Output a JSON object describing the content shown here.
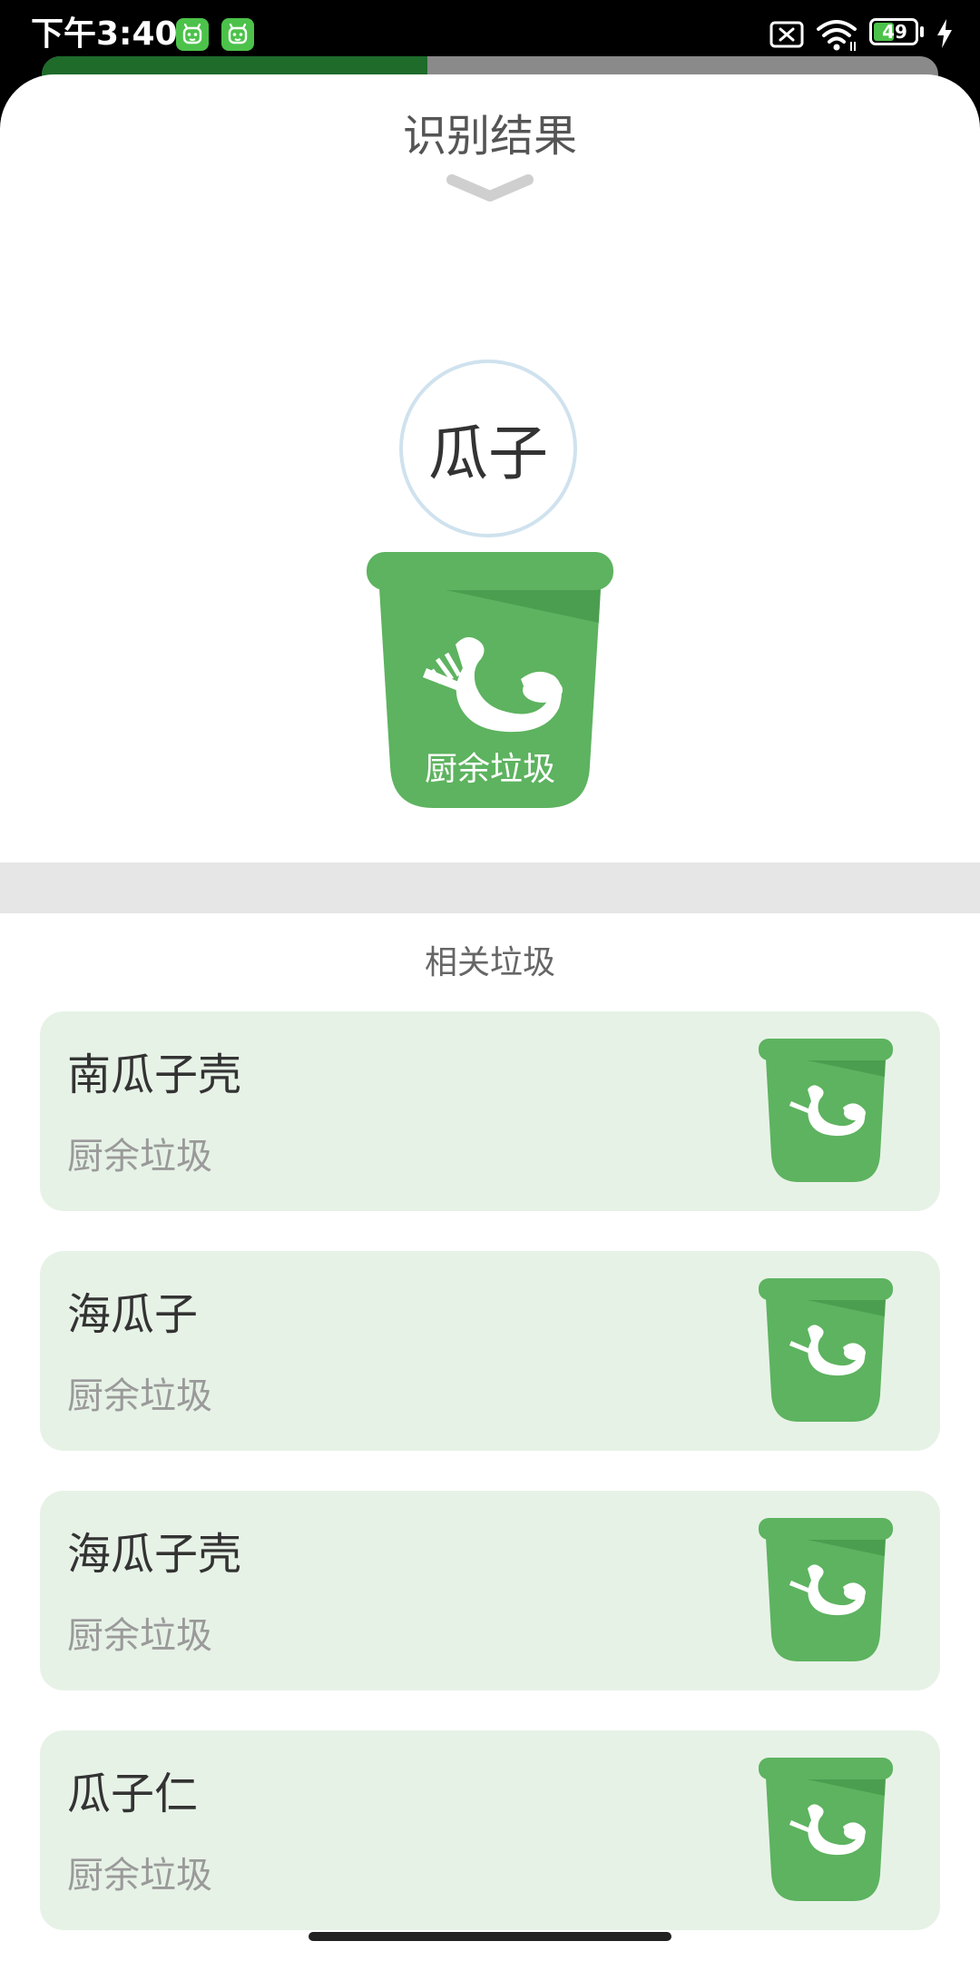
{
  "status_bar": {
    "time": "下午3:40",
    "battery_level": "49",
    "icons": [
      "app-notification-icon",
      "app-notification-icon",
      "sim-off-icon",
      "wifi-icon",
      "battery-icon",
      "charging-icon"
    ]
  },
  "progress_peek": {
    "fraction": 0.43,
    "colors": {
      "fill": "#1E6B2A",
      "track": "#8A8A8A"
    }
  },
  "header": {
    "title": "识别结果",
    "collapse_icon": "chevron-down-icon"
  },
  "result": {
    "item": "瓜子",
    "category": "厨余垃圾",
    "bin_icon": "kitchen-waste-bin-icon"
  },
  "related": {
    "section_title": "相关垃圾",
    "items": [
      {
        "name": "南瓜子壳",
        "category": "厨余垃圾",
        "icon": "kitchen-waste-bin-icon"
      },
      {
        "name": "海瓜子",
        "category": "厨余垃圾",
        "icon": "kitchen-waste-bin-icon"
      },
      {
        "name": "海瓜子壳",
        "category": "厨余垃圾",
        "icon": "kitchen-waste-bin-icon"
      },
      {
        "name": "瓜子仁",
        "category": "厨余垃圾",
        "icon": "kitchen-waste-bin-icon"
      }
    ]
  },
  "colors": {
    "bin_green": "#5DB35F",
    "bin_shade": "#3F8F45",
    "card_bg": "#E7F2E7",
    "band_gray": "#E6E6E6"
  }
}
